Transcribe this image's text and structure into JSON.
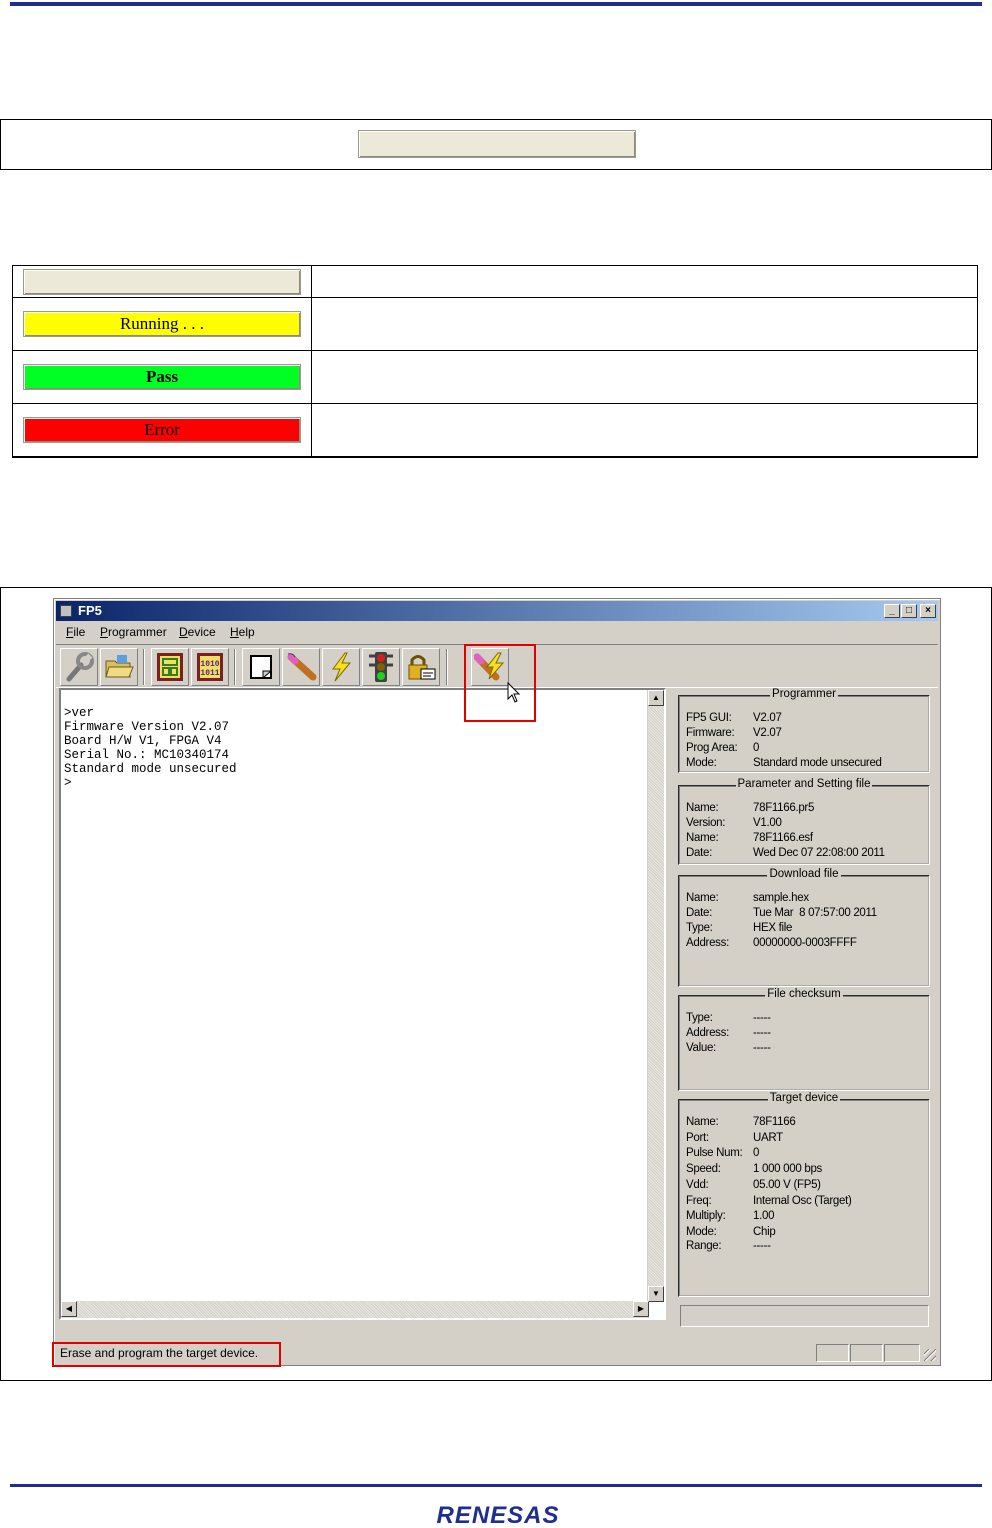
{
  "document": {
    "brand": "RENESAS",
    "status_legend": [
      {
        "label": "",
        "color": "#ece9d8"
      },
      {
        "label": "Running . . .",
        "color": "#ffff00"
      },
      {
        "label": "Pass",
        "color": "#00ff22"
      },
      {
        "label": "Error",
        "color": "#ff0000"
      }
    ],
    "accent_color": "#1f2f8f",
    "highlight_color": "#e00000"
  },
  "window": {
    "title": "FP5",
    "controls": {
      "minimize": "_",
      "maximize": "□",
      "close": "×"
    },
    "menu": [
      "File",
      "Programmer",
      "Device",
      "Help"
    ],
    "toolbar_icons": [
      "setup-icon",
      "open-folder-icon",
      "blank-check-icon",
      "read-memory-icon",
      "erase-icon",
      "program-icon",
      "verify-icon",
      "security-icon",
      "lock-icon",
      "autoprocedure-icon"
    ],
    "console_lines": [
      ">ver",
      "Firmware Version V2.07",
      "Board H/W V1, FPGA V4",
      "Serial No.: MC10340174",
      "Standard mode unsecured",
      ">"
    ],
    "panels": {
      "programmer": {
        "title": "Programmer",
        "rows": [
          {
            "k": "FP5 GUI:",
            "v": "V2.07"
          },
          {
            "k": "Firmware:",
            "v": "V2.07"
          },
          {
            "k": "Prog Area:",
            "v": "0"
          },
          {
            "k": "Mode:",
            "v": "Standard mode unsecured"
          }
        ]
      },
      "parameter": {
        "title": "Parameter and Setting file",
        "rows": [
          {
            "k": "Name:",
            "v": "78F1166.pr5"
          },
          {
            "k": "Version:",
            "v": "V1.00"
          },
          {
            "k": "Name:",
            "v": "78F1166.esf"
          },
          {
            "k": "Date:",
            "v": "Wed Dec 07 22:08:00 2011"
          }
        ]
      },
      "download": {
        "title": "Download file",
        "rows": [
          {
            "k": "Name:",
            "v": "sample.hex"
          },
          {
            "k": "Date:",
            "v": "Tue Mar  8 07:57:00 2011"
          },
          {
            "k": "Type:",
            "v": "HEX file"
          },
          {
            "k": "Address:",
            "v": "00000000-0003FFFF"
          }
        ]
      },
      "checksum": {
        "title": "File checksum",
        "rows": [
          {
            "k": "Type:",
            "v": "-----"
          },
          {
            "k": "Address:",
            "v": "-----"
          },
          {
            "k": "Value:",
            "v": "-----"
          }
        ]
      },
      "target": {
        "title": "Target device",
        "rows": [
          {
            "k": "Name:",
            "v": "78F1166"
          },
          {
            "k": "Port:",
            "v": "UART"
          },
          {
            "k": "Pulse Num:",
            "v": "0"
          },
          {
            "k": "Speed:",
            "v": "1 000 000 bps"
          },
          {
            "k": "Vdd:",
            "v": "05.00 V (FP5)"
          },
          {
            "k": "Freq:",
            "v": "Internal Osc (Target)"
          },
          {
            "k": "Multiply:",
            "v": "1.00"
          },
          {
            "k": "Mode:",
            "v": "Chip"
          },
          {
            "k": "Range:",
            "v": "-----"
          }
        ]
      }
    },
    "status_bar_text": "Erase and program the target device."
  }
}
